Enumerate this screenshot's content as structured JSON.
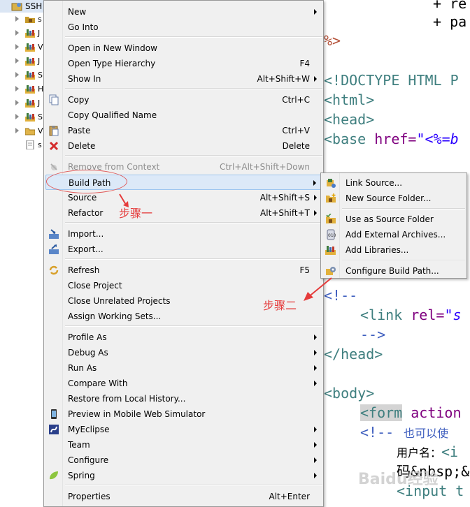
{
  "explorer": {
    "root_label": "SSH",
    "rows": [
      {
        "label": "s",
        "icon": "package-icon",
        "color": "#c79a2a"
      },
      {
        "label": "J",
        "icon": "library-icon",
        "color": "#3c7a3c"
      },
      {
        "label": "V",
        "icon": "library-icon",
        "color": "#3c7a3c"
      },
      {
        "label": "J",
        "icon": "library-icon",
        "color": "#3c7a3c"
      },
      {
        "label": "S",
        "icon": "library-icon",
        "color": "#3c7a3c"
      },
      {
        "label": "H",
        "icon": "library-icon",
        "color": "#3c7a3c"
      },
      {
        "label": "J",
        "icon": "library-icon",
        "color": "#3c7a3c"
      },
      {
        "label": "S",
        "icon": "library-icon",
        "color": "#3c7a3c"
      },
      {
        "label": "V",
        "icon": "folder-icon",
        "color": "#e0b44a"
      },
      {
        "label": "s",
        "icon": "file-icon",
        "color": "#6b6b6b"
      }
    ]
  },
  "editor": {
    "plus1": "+ re",
    "plus2": "+ pa",
    "pct_close": "%>",
    "doctype": "<!DOCTYPE HTML P",
    "html_open": "<html>",
    "head_open": "<head>",
    "base_tag": "<base",
    "base_attr": " href=",
    "base_val": "\"<%=b",
    "comment_open": "<!--",
    "link_tag": "<link",
    "link_attr": " rel=",
    "link_val": "\"s",
    "comment_close": "-->",
    "head_close": "</head>",
    "body_open": "<body>",
    "form_tag": "<form",
    "form_attr": " action",
    "comment2": "<!--",
    "comment2_text": "也可以使",
    "username": "用户名：",
    "username_tag": "<i",
    "nbsp": "码&nbsp;&",
    "input_tag": "<input t"
  },
  "menu": {
    "items": [
      {
        "label": "New",
        "shortcut": "",
        "submenu": true,
        "icon": ""
      },
      {
        "label": "Go Into",
        "shortcut": "",
        "submenu": false,
        "icon": ""
      },
      {
        "label": "Open in New Window",
        "shortcut": "",
        "submenu": false,
        "icon": ""
      },
      {
        "label": "Open Type Hierarchy",
        "shortcut": "F4",
        "submenu": false,
        "icon": ""
      },
      {
        "label": "Show In",
        "shortcut": "Alt+Shift+W",
        "submenu": true,
        "icon": ""
      },
      {
        "label": "Copy",
        "shortcut": "Ctrl+C",
        "submenu": false,
        "icon": "copy-icon"
      },
      {
        "label": "Copy Qualified Name",
        "shortcut": "",
        "submenu": false,
        "icon": ""
      },
      {
        "label": "Paste",
        "shortcut": "Ctrl+V",
        "submenu": false,
        "icon": "paste-icon"
      },
      {
        "label": "Delete",
        "shortcut": "Delete",
        "submenu": false,
        "icon": "delete-icon"
      },
      {
        "label": "Remove from Context",
        "shortcut": "Ctrl+Alt+Shift+Down",
        "submenu": false,
        "icon": "remove-context-icon",
        "disabled": true
      },
      {
        "label": "Build Path",
        "shortcut": "",
        "submenu": true,
        "icon": "",
        "hover": true
      },
      {
        "label": "Source",
        "shortcut": "Alt+Shift+S",
        "submenu": true,
        "icon": ""
      },
      {
        "label": "Refactor",
        "shortcut": "Alt+Shift+T",
        "submenu": true,
        "icon": ""
      },
      {
        "label": "Import...",
        "shortcut": "",
        "submenu": false,
        "icon": "import-icon"
      },
      {
        "label": "Export...",
        "shortcut": "",
        "submenu": false,
        "icon": "export-icon"
      },
      {
        "label": "Refresh",
        "shortcut": "F5",
        "submenu": false,
        "icon": "refresh-icon"
      },
      {
        "label": "Close Project",
        "shortcut": "",
        "submenu": false,
        "icon": ""
      },
      {
        "label": "Close Unrelated Projects",
        "shortcut": "",
        "submenu": false,
        "icon": ""
      },
      {
        "label": "Assign Working Sets...",
        "shortcut": "",
        "submenu": false,
        "icon": ""
      },
      {
        "label": "Profile As",
        "shortcut": "",
        "submenu": true,
        "icon": ""
      },
      {
        "label": "Debug As",
        "shortcut": "",
        "submenu": true,
        "icon": ""
      },
      {
        "label": "Run As",
        "shortcut": "",
        "submenu": true,
        "icon": ""
      },
      {
        "label": "Compare With",
        "shortcut": "",
        "submenu": true,
        "icon": ""
      },
      {
        "label": "Restore from Local History...",
        "shortcut": "",
        "submenu": false,
        "icon": ""
      },
      {
        "label": "Preview in Mobile Web Simulator",
        "shortcut": "",
        "submenu": false,
        "icon": "mobile-preview-icon"
      },
      {
        "label": "MyEclipse",
        "shortcut": "",
        "submenu": true,
        "icon": "myeclipse-icon"
      },
      {
        "label": "Team",
        "shortcut": "",
        "submenu": true,
        "icon": ""
      },
      {
        "label": "Configure",
        "shortcut": "",
        "submenu": true,
        "icon": ""
      },
      {
        "label": "Spring",
        "shortcut": "",
        "submenu": true,
        "icon": "spring-leaf-icon"
      },
      {
        "label": "Properties",
        "shortcut": "Alt+Enter",
        "submenu": false,
        "icon": ""
      }
    ]
  },
  "submenu": {
    "items": [
      {
        "label": "Link Source...",
        "icon": "link-source-icon"
      },
      {
        "label": "New Source Folder...",
        "icon": "new-source-folder-icon"
      },
      {
        "label": "Use as Source Folder",
        "icon": "use-source-folder-icon"
      },
      {
        "label": "Add External Archives...",
        "icon": "archive-icon"
      },
      {
        "label": "Add Libraries...",
        "icon": "library-icon"
      },
      {
        "label": "Configure Build Path...",
        "icon": "configure-build-path-icon"
      }
    ]
  },
  "annotations": {
    "step1": "步骤一",
    "step2": "步骤二",
    "color": "#e53b3b"
  },
  "watermark": "Baidu经验"
}
